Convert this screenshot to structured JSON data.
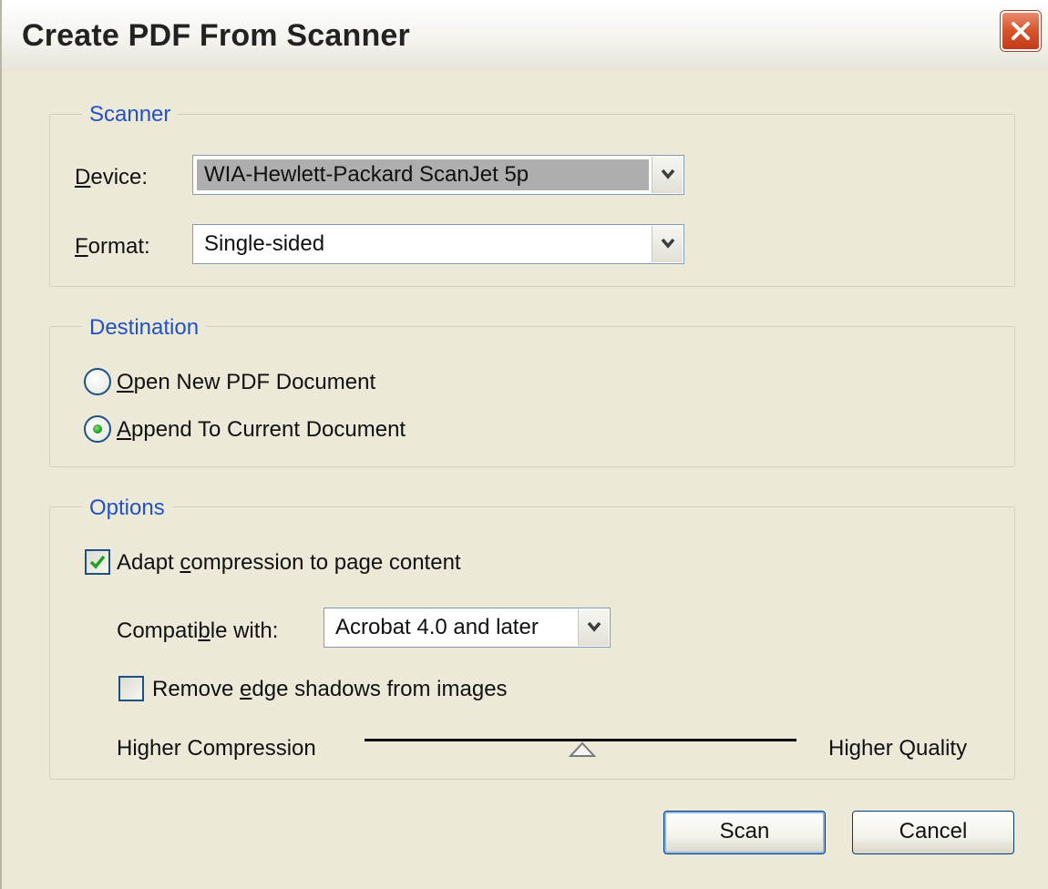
{
  "window": {
    "title": "Create PDF From Scanner"
  },
  "scanner": {
    "legend": "Scanner",
    "device_label": "Device:",
    "device_value": "WIA-Hewlett-Packard ScanJet 5p",
    "format_label": "Format:",
    "format_value": "Single-sided"
  },
  "destination": {
    "legend": "Destination",
    "options": [
      {
        "label": "Open New PDF Document",
        "selected": false
      },
      {
        "label": "Append To Current Document",
        "selected": true
      }
    ]
  },
  "options": {
    "legend": "Options",
    "adapt_compression_label": "Adapt compression to page content",
    "adapt_compression_checked": true,
    "compatible_label": "Compatible with:",
    "compatible_value": "Acrobat 4.0 and later",
    "remove_shadows_label": "Remove edge shadows from images",
    "remove_shadows_checked": false,
    "slider_left_label": "Higher Compression",
    "slider_right_label": "Higher Quality",
    "slider_position": 0.5
  },
  "buttons": {
    "scan": "Scan",
    "cancel": "Cancel"
  },
  "icons": {
    "close": "close-icon",
    "dropdown": "chevron-down-icon",
    "check": "checkmark-icon",
    "slider": "slider-thumb-icon"
  }
}
